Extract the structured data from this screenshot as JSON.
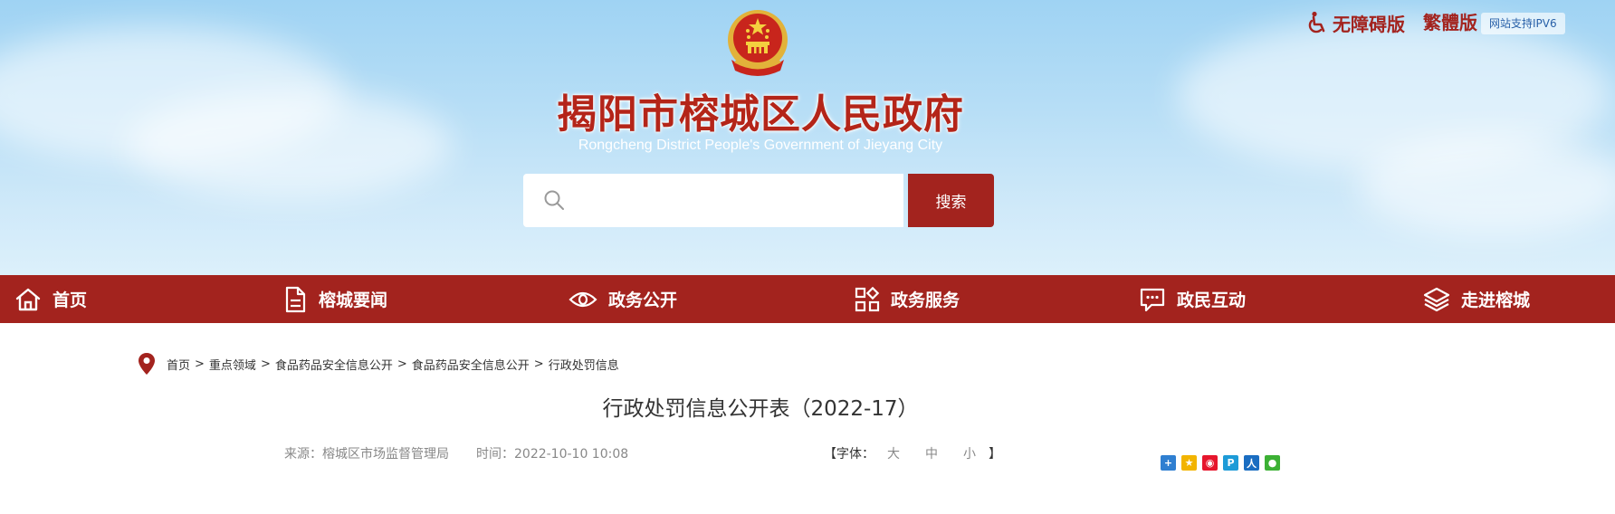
{
  "header": {
    "title": "揭阳市榕城区人民政府",
    "subtitle": "Rongcheng District People's Government of Jieyang City",
    "accessibility_label": "无障碍版",
    "traditional_label": "繁體版",
    "ipv6_label": "网站支持IPV6",
    "search": {
      "placeholder": "",
      "button_label": "搜索"
    }
  },
  "nav": {
    "items": [
      {
        "label": "首页",
        "icon": "home-icon"
      },
      {
        "label": "榕城要闻",
        "icon": "document-icon"
      },
      {
        "label": "政务公开",
        "icon": "eye-icon"
      },
      {
        "label": "政务服务",
        "icon": "grid-icon"
      },
      {
        "label": "政民互动",
        "icon": "chat-icon"
      },
      {
        "label": "走进榕城",
        "icon": "layers-icon"
      }
    ]
  },
  "breadcrumb": {
    "items": [
      "首页",
      "重点领域",
      "食品药品安全信息公开",
      "食品药品安全信息公开",
      "行政处罚信息"
    ],
    "separator": ">"
  },
  "article": {
    "title": "行政处罚信息公开表（2022-17）",
    "source": "来源：榕城区市场监督管理局",
    "time": "时间：2022-10-10 10:08",
    "font_size_prefix": "【字体：",
    "font_size_large": "大",
    "font_size_medium": "中",
    "font_size_small": "小",
    "font_size_suffix": "】"
  },
  "share": {
    "buttons": [
      "more-share-icon",
      "qzone-icon",
      "weibo-icon",
      "tencent-weibo-icon",
      "renren-icon",
      "wechat-icon"
    ]
  },
  "colors": {
    "brand_red": "#a3231e",
    "title_red": "#b42519",
    "link_blue": "#2860a8"
  }
}
